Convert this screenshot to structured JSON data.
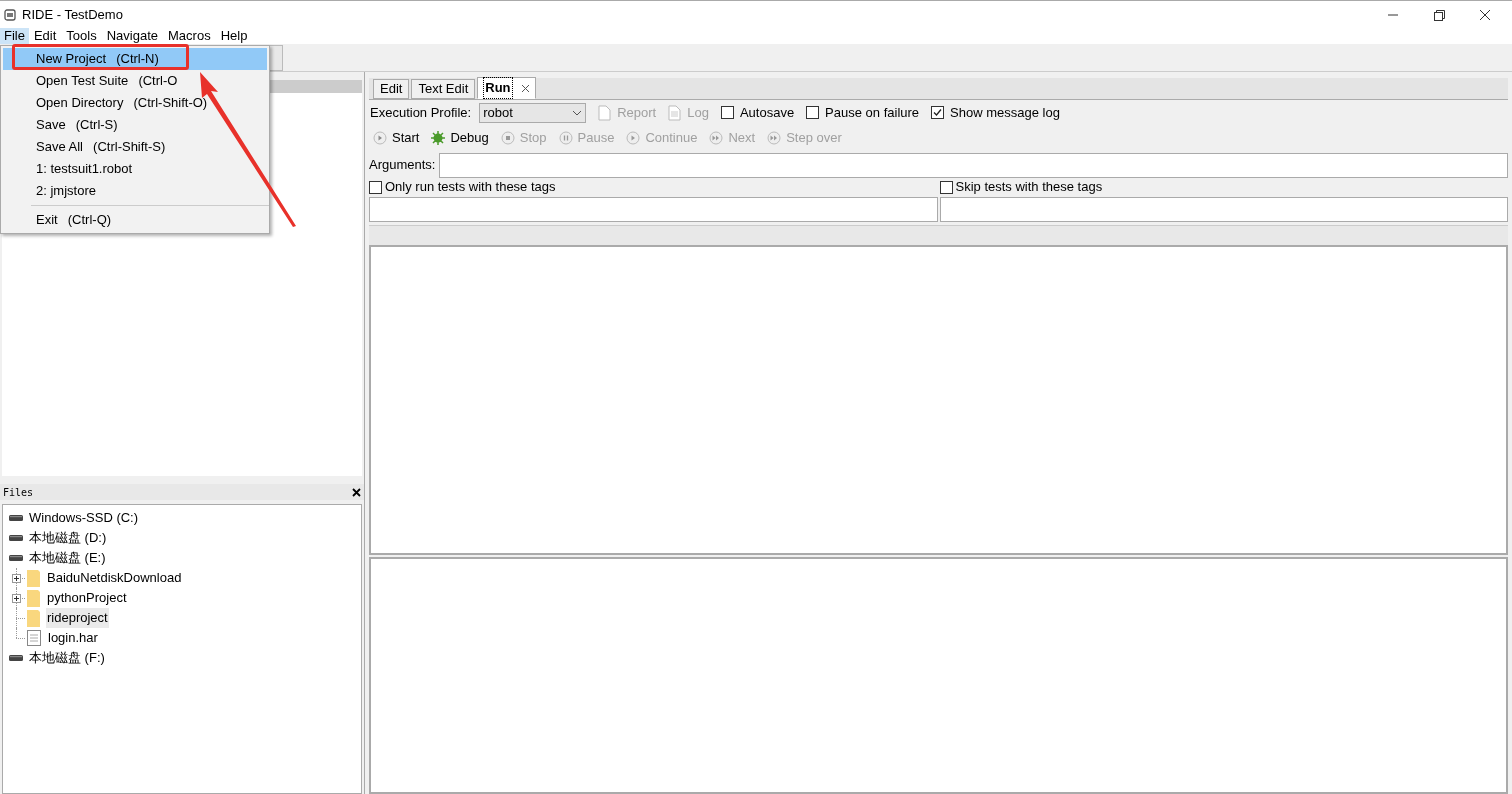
{
  "window": {
    "title": "RIDE - TestDemo"
  },
  "menu_bar": [
    {
      "label": "File",
      "selected": true
    },
    {
      "label": "Edit",
      "selected": false
    },
    {
      "label": "Tools",
      "selected": false
    },
    {
      "label": "Navigate",
      "selected": false
    },
    {
      "label": "Macros",
      "selected": false
    },
    {
      "label": "Help",
      "selected": false
    }
  ],
  "file_menu": [
    {
      "kind": "item",
      "label": "New Project",
      "shortcut": "(Ctrl-N)",
      "highlighted": true
    },
    {
      "kind": "item",
      "label": "Open Test Suite",
      "shortcut": "(Ctrl-O",
      "highlighted": false
    },
    {
      "kind": "item",
      "label": "Open Directory",
      "shortcut": "(Ctrl-Shift-O)",
      "highlighted": false
    },
    {
      "kind": "item",
      "label": "Save",
      "shortcut": "(Ctrl-S)",
      "highlighted": false
    },
    {
      "kind": "item",
      "label": "Save All",
      "shortcut": "(Ctrl-Shift-S)",
      "highlighted": false
    },
    {
      "kind": "item",
      "label": "1: testsuit1.robot",
      "highlighted": false
    },
    {
      "kind": "item",
      "label": "2: jmjstore",
      "highlighted": false
    },
    {
      "kind": "separator"
    },
    {
      "kind": "item",
      "label": "Exit",
      "shortcut": "(Ctrl-Q)",
      "highlighted": false
    }
  ],
  "editor_tabs": [
    {
      "label": "Edit",
      "selected": false
    },
    {
      "label": "Text Edit",
      "selected": false
    },
    {
      "label": "Run",
      "selected": true
    }
  ],
  "run_options": {
    "profile_label": "Execution Profile:",
    "profile_value": "robot",
    "items": [
      {
        "kind": "button",
        "label": "Report",
        "disabled": true
      },
      {
        "kind": "button",
        "label": "Log",
        "disabled": true
      },
      {
        "kind": "checkbox",
        "label": "Autosave",
        "checked": false
      },
      {
        "kind": "checkbox",
        "label": "Pause on failure",
        "checked": false
      },
      {
        "kind": "checkbox",
        "label": "Show message log",
        "checked": true
      }
    ]
  },
  "run_controls": [
    {
      "label": "Start",
      "disabled": false
    },
    {
      "label": "Debug",
      "disabled": false
    },
    {
      "label": "Stop",
      "disabled": true
    },
    {
      "label": "Pause",
      "disabled": true
    },
    {
      "label": "Continue",
      "disabled": true
    },
    {
      "label": "Next",
      "disabled": true
    },
    {
      "label": "Step over",
      "disabled": true
    }
  ],
  "arguments": {
    "label": "Arguments:"
  },
  "tag_filters": [
    {
      "label": "Only run tests with these tags",
      "checked": false
    },
    {
      "label": "Skip tests with these tags",
      "checked": false
    }
  ],
  "files_panel": {
    "title": "Files",
    "tree": [
      {
        "kind": "drive",
        "label": "Windows-SSD (C:)"
      },
      {
        "kind": "drive",
        "label": "本地磁盘 (D:)"
      },
      {
        "kind": "drive",
        "label": "本地磁盘 (E:)",
        "children": [
          {
            "kind": "folder",
            "label": "BaiduNetdiskDownload",
            "expandable": true,
            "selected": false
          },
          {
            "kind": "folder",
            "label": "pythonProject",
            "expandable": true,
            "selected": false
          },
          {
            "kind": "folder",
            "label": "rideproject",
            "expandable": false,
            "selected": true
          },
          {
            "kind": "file",
            "label": "login.har",
            "expandable": false,
            "selected": false
          }
        ]
      },
      {
        "kind": "drive",
        "label": "本地磁盘 (F:)"
      }
    ]
  }
}
